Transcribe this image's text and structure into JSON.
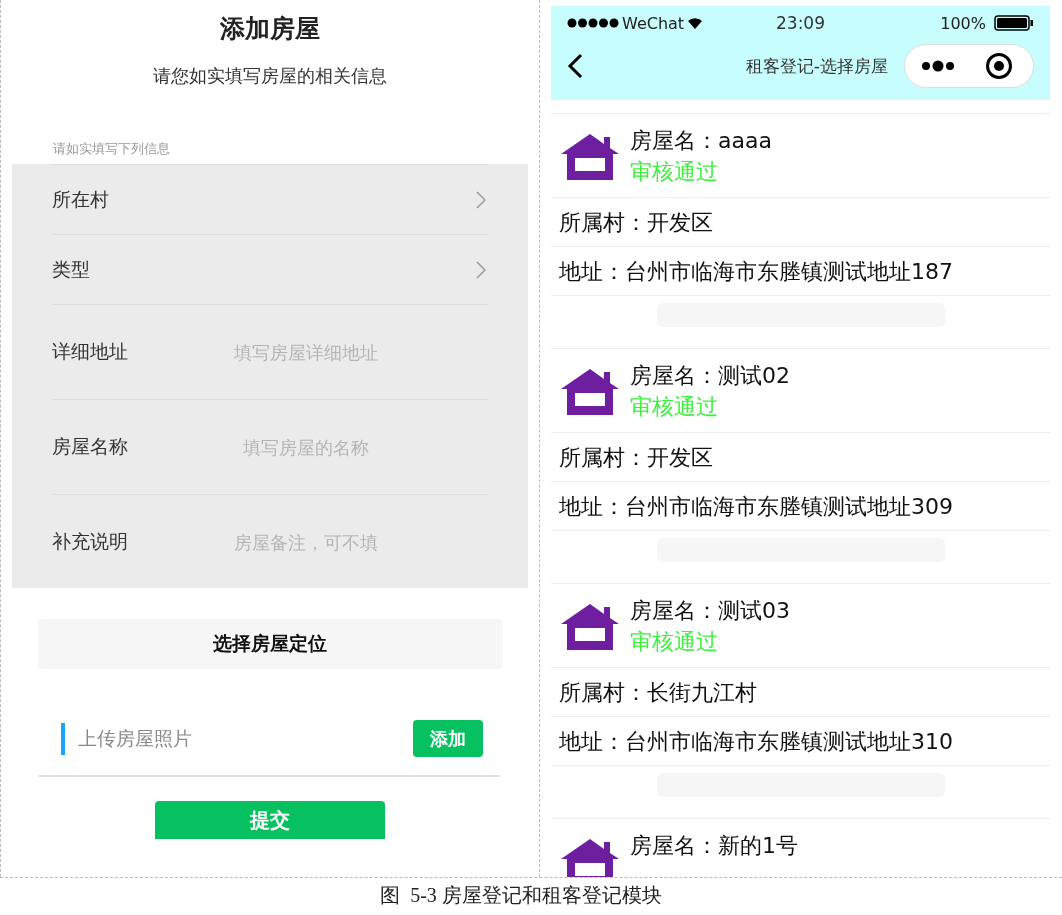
{
  "left": {
    "title": "添加房屋",
    "subtitle": "请您如实填写房屋的相关信息",
    "section_hint": "请如实填写下列信息",
    "fields": [
      {
        "kind": "select",
        "label": "所在村"
      },
      {
        "kind": "select",
        "label": "类型"
      },
      {
        "kind": "input",
        "label": "详细地址",
        "placeholder": "填写房屋详细地址"
      },
      {
        "kind": "input",
        "label": "房屋名称",
        "placeholder": "填写房屋的名称"
      },
      {
        "kind": "input",
        "label": "补充说明",
        "placeholder": "房屋备注，可不填"
      }
    ],
    "location_button": "选择房屋定位",
    "photo": {
      "label": "上传房屋照片",
      "button": "添加"
    },
    "submit": "提交"
  },
  "right": {
    "status_bar": {
      "carrier": "WeChat",
      "time": "23:09",
      "battery": "100%"
    },
    "nav": {
      "title": "租客登记-选择房屋"
    },
    "houses": [
      {
        "name": "房屋名：aaaa",
        "status": "审核通过",
        "village": "所属村：开发区",
        "address": "地址：台州市临海市东塍镇测试地址187"
      },
      {
        "name": "房屋名：测试02",
        "status": "审核通过",
        "village": "所属村：开发区",
        "address": "地址：台州市临海市东塍镇测试地址309"
      },
      {
        "name": "房屋名：测试03",
        "status": "审核通过",
        "village": "所属村：长街九江村",
        "address": "地址：台州市临海市东塍镇测试地址310"
      },
      {
        "name": "房屋名：新的1号"
      }
    ]
  },
  "caption": "图  5-3 房屋登记和租客登记模块"
}
